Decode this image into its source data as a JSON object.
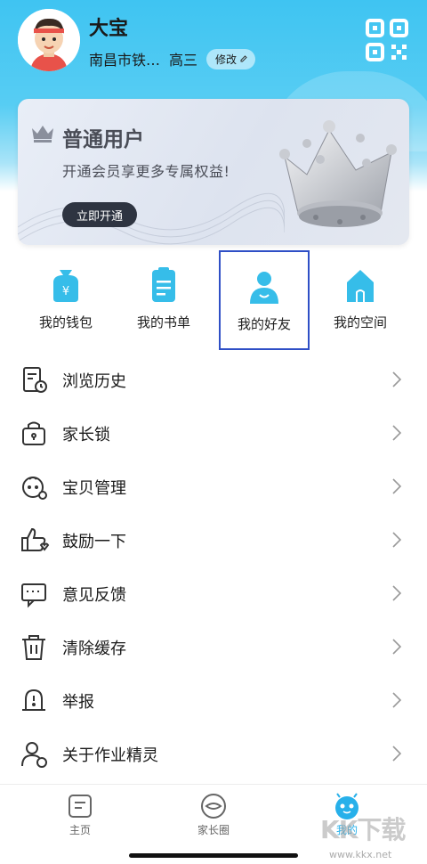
{
  "profile": {
    "name": "大宝",
    "school": "南昌市铁…",
    "grade": "高三",
    "edit_label": "修改"
  },
  "member_card": {
    "title": "普通用户",
    "subtitle": "开通会员享更多专属权益!",
    "button_label": "立即开通"
  },
  "quick_actions": [
    {
      "label": "我的钱包",
      "icon": "wallet-icon"
    },
    {
      "label": "我的书单",
      "icon": "booklist-icon"
    },
    {
      "label": "我的好友",
      "icon": "friend-icon",
      "highlighted": true
    },
    {
      "label": "我的空间",
      "icon": "space-icon"
    }
  ],
  "menu": [
    {
      "label": "浏览历史",
      "icon": "history-icon"
    },
    {
      "label": "家长锁",
      "icon": "parent-lock-icon"
    },
    {
      "label": "宝贝管理",
      "icon": "baby-manage-icon"
    },
    {
      "label": "鼓励一下",
      "icon": "thumbs-up-icon"
    },
    {
      "label": "意见反馈",
      "icon": "feedback-icon"
    },
    {
      "label": "清除缓存",
      "icon": "trash-icon"
    },
    {
      "label": "举报",
      "icon": "report-icon"
    },
    {
      "label": "关于作业精灵",
      "icon": "about-icon"
    }
  ],
  "tabbar": [
    {
      "label": "主页",
      "icon": "home-icon"
    },
    {
      "label": "家长圈",
      "icon": "parent-circle-icon"
    },
    {
      "label": "我的",
      "icon": "mine-icon",
      "active": true
    }
  ],
  "watermark": {
    "logo": "KK下载",
    "url": "www.kkx.net"
  },
  "colors": {
    "header_blue": "#3fc4f2",
    "accent_blue": "#27b0ea",
    "highlight_border": "#2f4fc6",
    "card_button": "#2e3441"
  }
}
